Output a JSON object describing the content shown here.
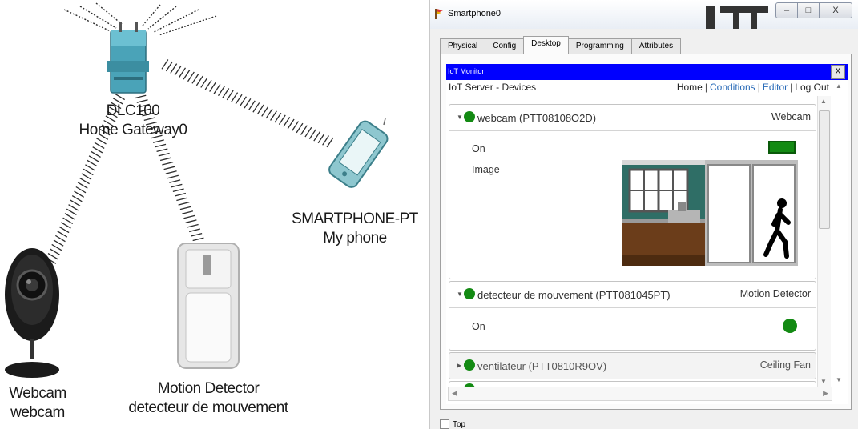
{
  "topology": {
    "gateway": {
      "line1": "DLC100",
      "line2": "Home Gateway0"
    },
    "phone": {
      "line1": "SMARTPHONE-PT",
      "line2": "My phone"
    },
    "webcam": {
      "line1": "Webcam",
      "line2": "webcam"
    },
    "motion": {
      "line1": "Motion Detector",
      "line2": "detecteur de mouvement"
    }
  },
  "window": {
    "title": "Smartphone0",
    "controls": {
      "minimize": "–",
      "maximize": "□",
      "close": "X"
    },
    "tabs": [
      "Physical",
      "Config",
      "Desktop",
      "Programming",
      "Attributes"
    ],
    "active_tab": "Desktop",
    "top_checkbox_label": "Top"
  },
  "iot_monitor": {
    "title": "IoT Monitor",
    "close_label": "X",
    "header_left": "IoT Server - Devices",
    "nav": {
      "home": "Home",
      "conditions": "Conditions",
      "editor": "Editor",
      "logout": "Log Out",
      "separator": "|"
    }
  },
  "devices": [
    {
      "name": "webcam (PTT08108O2D)",
      "type": "Webcam",
      "status_color": "#138a13",
      "fields": [
        {
          "label": "On",
          "control": "toggle"
        },
        {
          "label": "Image",
          "control": "image"
        }
      ]
    },
    {
      "name": "detecteur de mouvement (PTT081045PT)",
      "type": "Motion Detector",
      "status_color": "#138a13",
      "fields": [
        {
          "label": "On",
          "control": "dot"
        }
      ]
    },
    {
      "name": "ventilateur (PTT0810R9OV)",
      "type": "Ceiling Fan",
      "status_color": "#138a13",
      "fields": []
    }
  ],
  "colors": {
    "monitor_bar": "#0000ff",
    "status_green": "#138a13",
    "link": "#2a6bb8"
  }
}
